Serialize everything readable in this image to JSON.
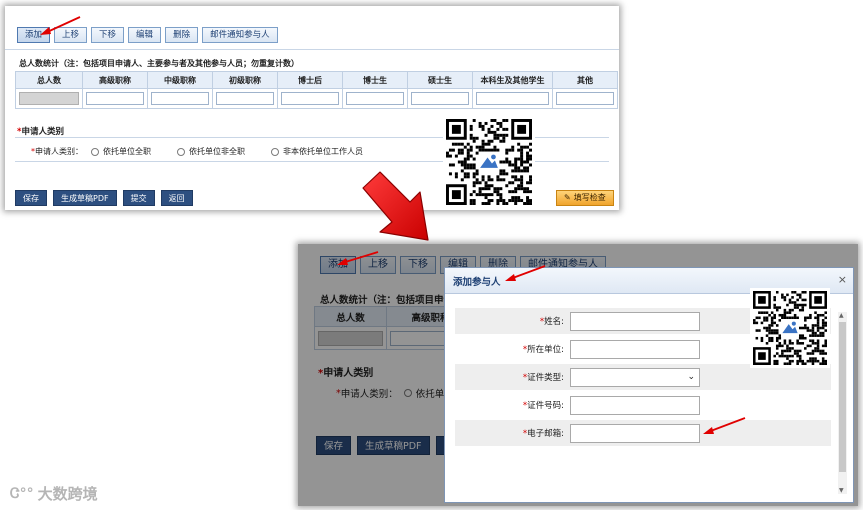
{
  "toolbar": {
    "add": "添加",
    "move_up": "上移",
    "move_down": "下移",
    "edit": "编辑",
    "delete": "删除",
    "email_notify": "邮件通知参与人"
  },
  "stats": {
    "title": "总人数统计（注：包括项目申请人、主要参与者及其他参与人员；勿重复计数）",
    "title_short": "总人数统计（注：包括项目申请",
    "headers": [
      "总人数",
      "高级职称",
      "中级职称",
      "初级职称",
      "博士后",
      "博士生",
      "硕士生",
      "本科生及其他学生",
      "其他"
    ]
  },
  "applicant_type": {
    "section_title": "申请人类别",
    "label": "申请人类别：",
    "options": [
      "依托单位全职",
      "依托单位非全职",
      "非本依托单位工作人员"
    ],
    "option_truncated": "依托单位"
  },
  "bottom_actions": {
    "save": "保存",
    "generate_pdf": "生成草稿PDF",
    "submit": "提交",
    "back": "返回",
    "fill_check": "填写检查"
  },
  "dialog": {
    "title": "添加参与人",
    "close": "×",
    "fields": [
      {
        "label": "姓名:"
      },
      {
        "label": "所在单位:"
      },
      {
        "label": "证件类型:"
      },
      {
        "label": "证件号码:"
      },
      {
        "label": "电子邮箱:"
      }
    ]
  },
  "watermark": {
    "logo_text": "Ꮳ°°",
    "brand": "大数跨境"
  },
  "colors": {
    "arrow_red": "#e00000",
    "button_navy": "#2d4f80",
    "dialog_title": "#1d3f73"
  }
}
